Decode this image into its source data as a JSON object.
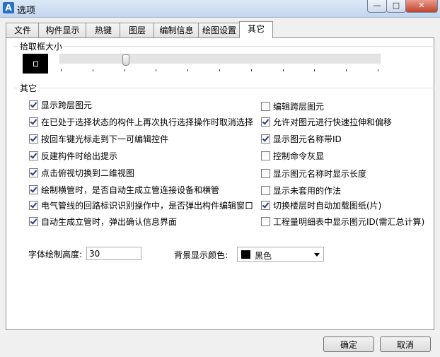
{
  "window": {
    "title": "选项",
    "app_icon_letter": "A",
    "min_glyph": "—",
    "max_glyph": "□",
    "close_glyph": "✕"
  },
  "tabs": [
    "文件",
    "构件显示",
    "热键",
    "图层",
    "编制信息",
    "绘图设置",
    "其它"
  ],
  "active_tab": "其它",
  "pickbox": {
    "label": "拾取框大小",
    "level_fraction": 0.2
  },
  "other": {
    "label": "其它"
  },
  "left_options": [
    {
      "label": "显示跨层图元",
      "checked": true
    },
    {
      "label": "在已处于选择状态的构件上再次执行选择操作时取消选择",
      "checked": true
    },
    {
      "label": "按回车键光标走到下一可编辑控件",
      "checked": true
    },
    {
      "label": "反建构件时给出提示",
      "checked": true
    },
    {
      "label": "点击俯视切换到二维视图",
      "checked": true
    },
    {
      "label": "绘制横管时，是否自动生成立管连接设备和横管",
      "checked": true
    },
    {
      "label": "电气管线的回路标识识别操作中，是否弹出构件编辑窗口",
      "checked": true
    },
    {
      "label": "自动生成立管时，弹出确认信息界面",
      "checked": true
    }
  ],
  "right_options": [
    {
      "label": "编辑跨层图元",
      "checked": false
    },
    {
      "label": "允许对图元进行快速拉伸和偏移",
      "checked": true
    },
    {
      "label": "显示图元名称带ID",
      "checked": true
    },
    {
      "label": "控制命令灰显",
      "checked": false
    },
    {
      "label": "显示图元名称时显示长度",
      "checked": false
    },
    {
      "label": "显示未套用的作法",
      "checked": false
    },
    {
      "label": "切换楼层时自动加载图纸(片)",
      "checked": true
    },
    {
      "label": "工程量明细表中显示图元ID(需汇总计算)",
      "checked": false
    }
  ],
  "font_height": {
    "label": "字体绘制高度:",
    "value": "30"
  },
  "bg_color": {
    "label": "背景显示颜色:",
    "value": "黑色",
    "swatch": "#000000"
  },
  "buttons": {
    "ok": "确定",
    "cancel": "取消"
  }
}
